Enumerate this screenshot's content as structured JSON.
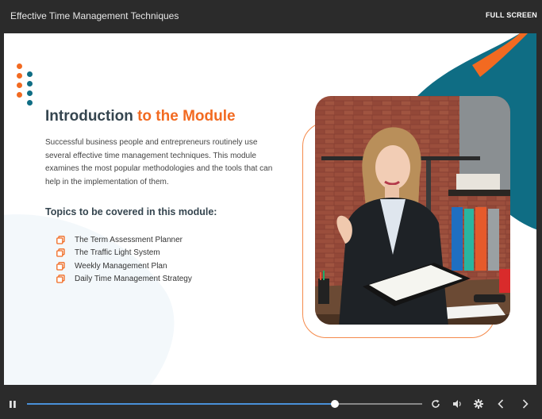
{
  "window": {
    "title": "Effective Time Management Techniques",
    "full_screen_label": "FULL SCREEN"
  },
  "slide": {
    "heading_main": "Introduction",
    "heading_accent": "to the Module",
    "body": "Successful business people and entrepreneurs routinely use several effective time management techniques. This module examines the most popular methodologies and the tools that can help in the implementation of them.",
    "topics_heading": "Topics to be covered in this module:",
    "topics": [
      "The Term Assessment Planner",
      "The Traffic Light System",
      "Weekly Management Plan",
      "Daily Time Management Strategy"
    ],
    "photo_icon": "woman-reading-folder-photo"
  },
  "player": {
    "progress": 0.78,
    "controls": [
      "pause-icon",
      "replay-icon",
      "volume-icon",
      "gear-icon",
      "chevron-left-icon",
      "chevron-right-icon"
    ]
  },
  "colors": {
    "accent_orange": "#f26a21",
    "accent_teal": "#0f6d84",
    "heading_dark": "#35454f",
    "progress_blue": "#4a90d9",
    "bar_background": "#2b2b2b"
  }
}
